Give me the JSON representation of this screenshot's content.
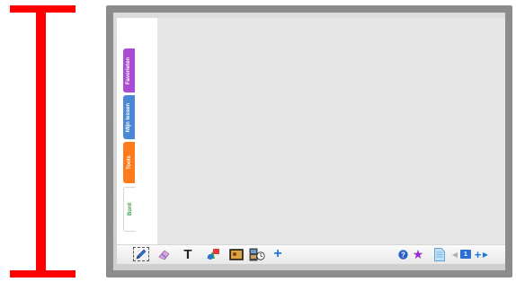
{
  "sidebar": {
    "tabs": [
      {
        "label": "Favorieten"
      },
      {
        "label": "Mijn lessen"
      },
      {
        "label": "Tools"
      },
      {
        "label": "Bord"
      }
    ]
  },
  "toolbar": {
    "text_tool_label": "T",
    "add_label": "+",
    "help_label": "?",
    "star_label": "★",
    "prev_label": "◀",
    "page_number": "1",
    "add_page_label": "+",
    "next_label": "▶"
  },
  "icons": [
    "pen-icon",
    "eraser-icon",
    "shapes-icon",
    "image-icon",
    "media-icon",
    "help-icon",
    "star-icon",
    "page-icon"
  ],
  "colors": {
    "annotation_red": "#ff0000",
    "frame_gray": "#8c8c8c",
    "tab_favorieten": "#a94bd3",
    "tab_mijn_lessen": "#4a88d6",
    "tab_tools": "#ff7a1a",
    "tab_bord_text": "#39a03d",
    "accent_blue": "#2176d9"
  }
}
